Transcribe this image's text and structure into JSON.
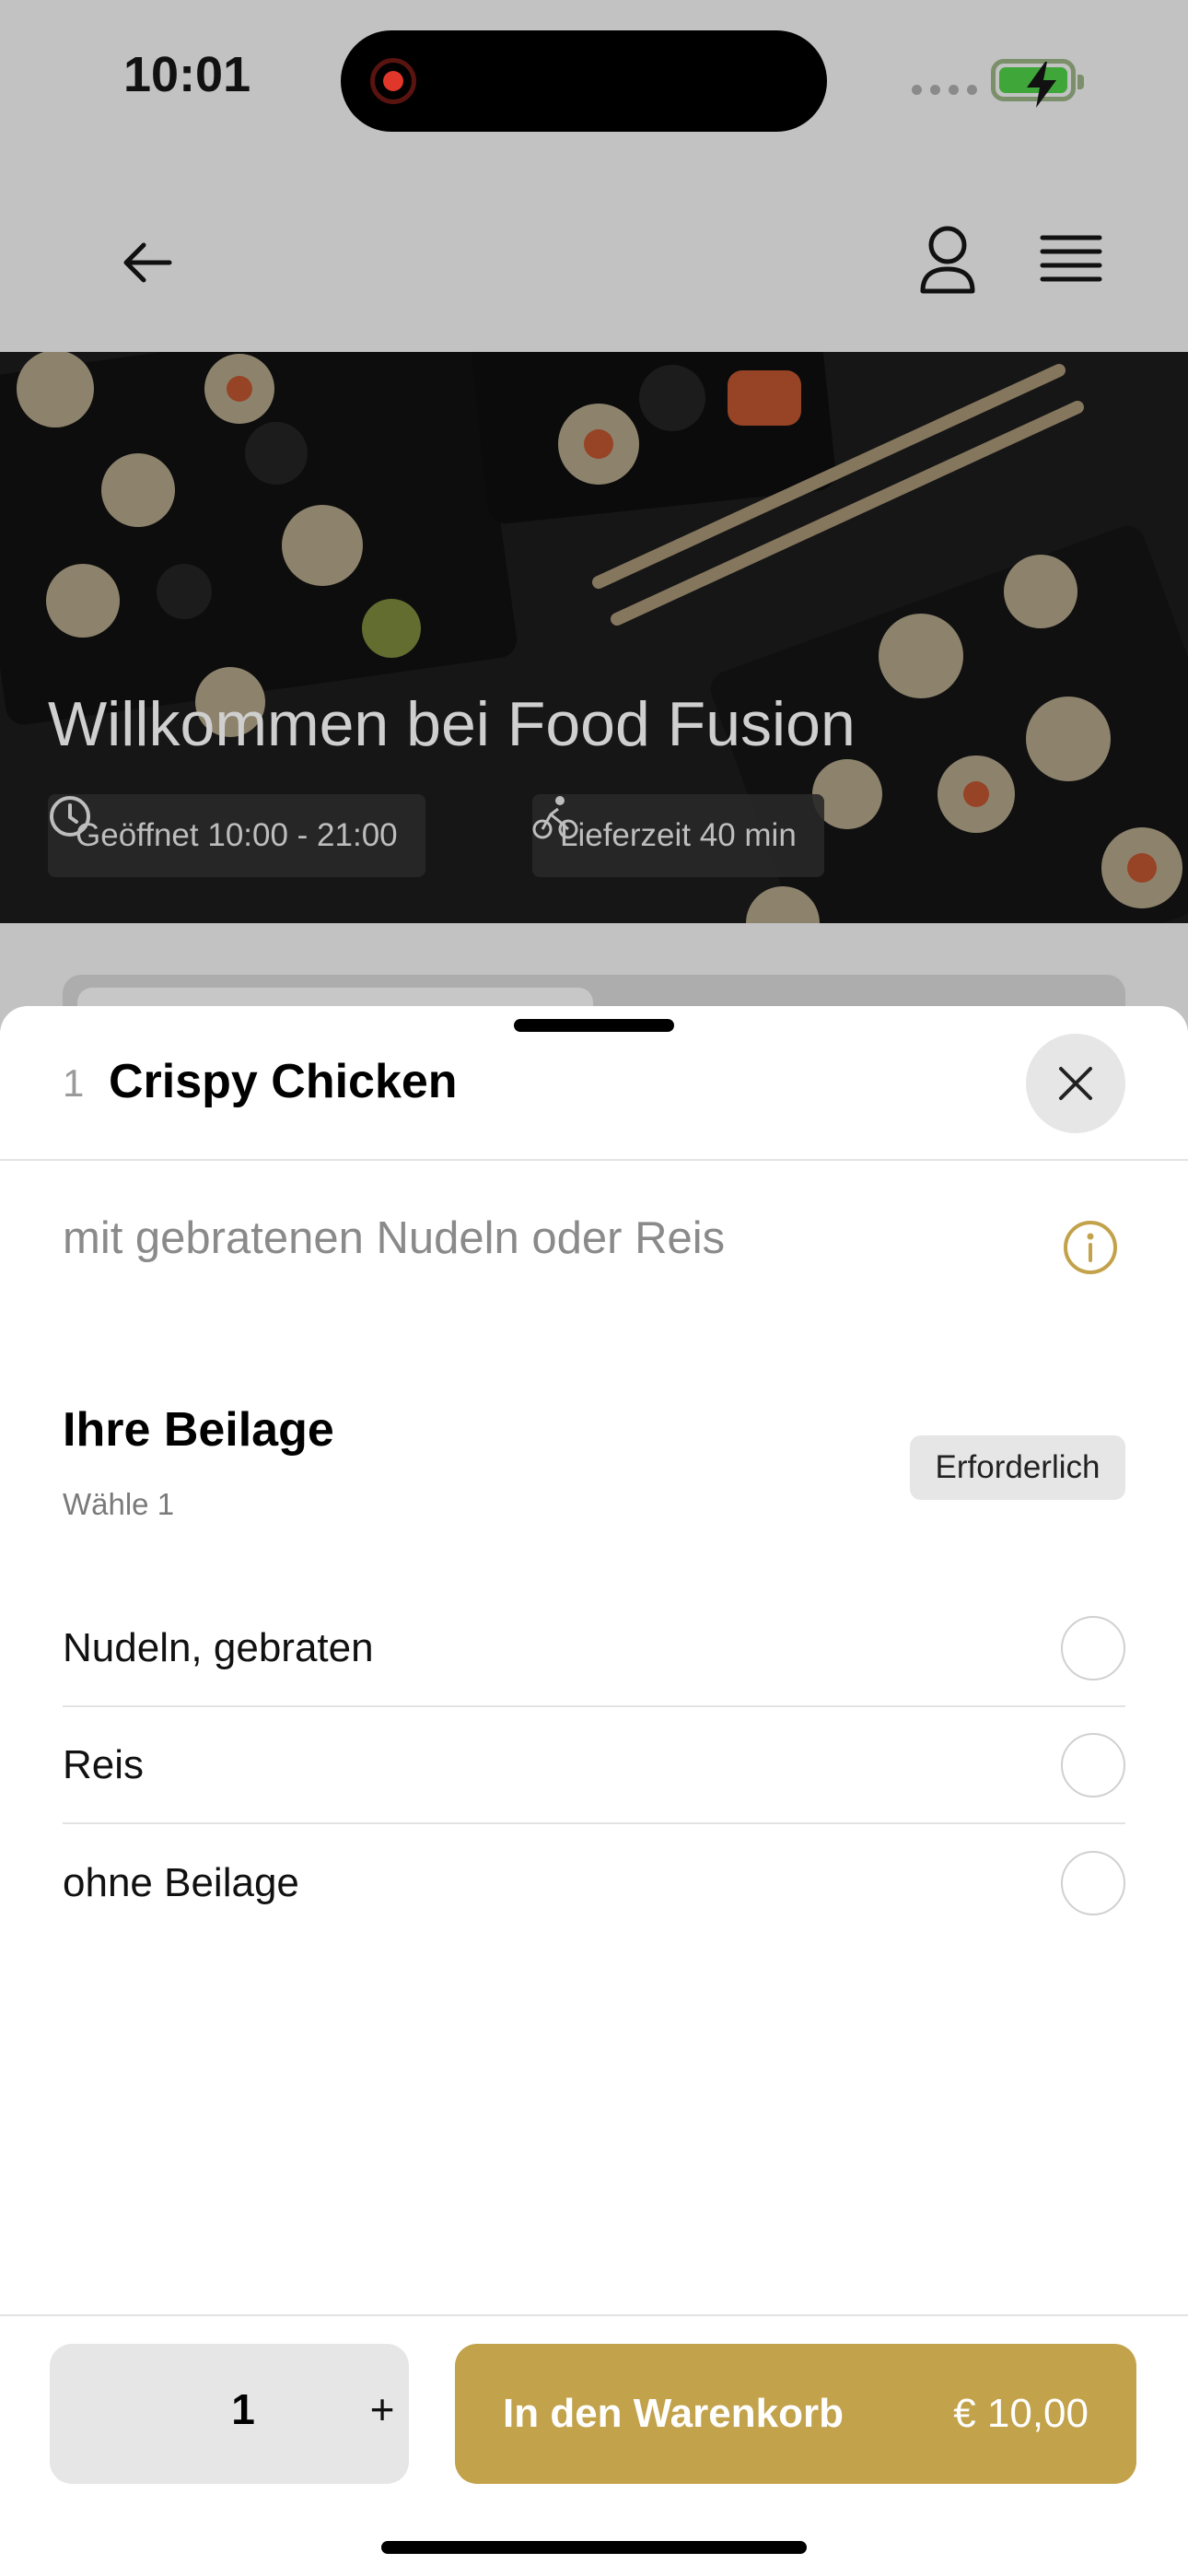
{
  "status_bar": {
    "time": "10:01"
  },
  "hero": {
    "title": "Willkommen bei Food Fusion",
    "opening_hours": "Geöffnet 10:00 - 21:00",
    "delivery_time": "Lieferzeit 40 min"
  },
  "sheet": {
    "item_quantity": "1",
    "item_title": "Crispy Chicken",
    "description": "mit gebratenen Nudeln oder Reis",
    "group": {
      "title": "Ihre Beilage",
      "subtitle": "Wähle 1",
      "badge": "Erforderlich",
      "options": [
        {
          "label": "Nudeln, gebraten",
          "selected": false
        },
        {
          "label": "Reis",
          "selected": false
        },
        {
          "label": "ohne Beilage",
          "selected": false
        }
      ]
    },
    "footer": {
      "quantity": "1",
      "plus": "+",
      "add_to_cart": "In den Warenkorb",
      "price": "€ 10,00"
    }
  },
  "colors": {
    "accent": "#c2a24a",
    "overlay_bg": "#c2c2c2",
    "sheet_bg": "#ffffff",
    "chip_bg": "#e6e6e6"
  },
  "icons": [
    "back-arrow-icon",
    "profile-icon",
    "menu-icon",
    "clock-icon",
    "bicycle-icon",
    "close-icon",
    "info-icon"
  ]
}
